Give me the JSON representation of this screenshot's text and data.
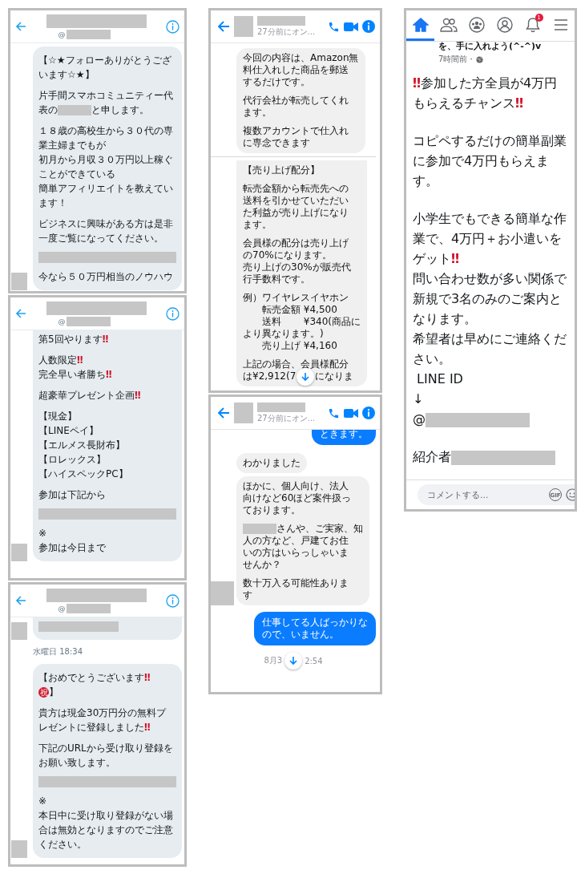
{
  "columns": [
    {
      "panels": [
        {
          "kind": "twitter_dm",
          "header": {
            "handle": "@"
          },
          "items": [
            {
              "kind": "received",
              "continued": false,
              "avatar": true,
              "paragraphs": [
                [
                  "【☆★フォローありがとうござ",
                  "います☆★】"
                ],
                [
                  "片手間スマホコミュニティー代",
                  [
                    {
                      "text": "表の"
                    },
                    {
                      "kind": "redacted_short"
                    },
                    {
                      "text": "と申します。"
                    }
                  ]
                ],
                [
                  "１８歳の高校生から３０代の専",
                  "業主婦までもが",
                  "初月から月収３０万円以上稼ぐ",
                  "ことができている",
                  "簡単アフィリエイトを教えてい",
                  "ます！"
                ],
                [
                  "ビジネスに興味がある方は是非",
                  "一度ご覧になってください。"
                ],
                [
                  [
                    {
                      "kind": "redacted_line"
                    }
                  ]
                ],
                [
                  "今なら５０万円相当のノウハウ"
                ]
              ]
            }
          ]
        },
        {
          "kind": "twitter_dm",
          "header": {
            "handle": "@"
          },
          "items": [
            {
              "kind": "received",
              "continued": true,
              "avatar": true,
              "paragraphs": [
                [
                  [
                    {
                      "text": "第5回やります"
                    },
                    {
                      "kind": "emoji",
                      "text": "‼"
                    }
                  ]
                ],
                [
                  [
                    {
                      "text": "人数限定"
                    },
                    {
                      "kind": "emoji",
                      "text": "‼"
                    }
                  ],
                  [
                    {
                      "text": "完全早い者勝ち"
                    },
                    {
                      "kind": "emoji",
                      "text": "‼"
                    }
                  ]
                ],
                [
                  [
                    {
                      "text": "超豪華プレゼント企画"
                    },
                    {
                      "kind": "emoji",
                      "text": "‼"
                    }
                  ]
                ],
                [
                  "【現金】",
                  "【LINEペイ】",
                  "【エルメス長財布】",
                  "【ロレックス】",
                  "【ハイスペックPC】"
                ],
                [
                  "参加は下記から"
                ],
                [
                  [
                    {
                      "kind": "redacted_line"
                    }
                  ]
                ],
                [
                  "※",
                  "参加は今日まで"
                ]
              ]
            }
          ]
        },
        {
          "kind": "twitter_dm",
          "header": {
            "handle": "@"
          },
          "items": [
            {
              "kind": "received",
              "continued": true,
              "avatar": true,
              "paragraphs": [
                [
                  [
                    {
                      "kind": "redacted_medium"
                    }
                  ]
                ]
              ]
            },
            {
              "kind": "timestamp",
              "segments": [
                {
                  "text": "水曜日 18:34"
                }
              ]
            },
            {
              "kind": "received",
              "continued": false,
              "avatar": true,
              "paragraphs": [
                [
                  [
                    {
                      "text": "【おめでとうございます"
                    },
                    {
                      "kind": "emoji",
                      "text": "‼"
                    }
                  ],
                  [
                    {
                      "kind": "badge",
                      "text": "祝"
                    },
                    {
                      "text": "】"
                    }
                  ]
                ],
                [
                  "貴方は現金30万円分の無料プ",
                  [
                    {
                      "text": "レゼントに登録しました"
                    },
                    {
                      "kind": "emoji",
                      "text": "‼"
                    }
                  ]
                ],
                [
                  "下記のURLから受け取り登録を",
                  "お願い致します。"
                ],
                [
                  [
                    {
                      "kind": "redacted_line"
                    }
                  ]
                ],
                [
                  "※",
                  "本日中に受け取り登録がない場",
                  "合は無効となりますのでご注意",
                  "ください。"
                ]
              ]
            }
          ]
        }
      ]
    },
    {
      "panels": [
        {
          "kind": "messenger",
          "header": {
            "status": "27分前にオン..."
          },
          "items": [
            {
              "kind": "received",
              "continued": false,
              "avatar": false,
              "paragraphs": [
                [
                  "今回の内容は、Amazon無",
                  "料仕入れした商品を郵送",
                  "するだけです。"
                ],
                [
                  "代行会社が転売してくれ",
                  "ます。"
                ],
                [
                  "複数アカウントで仕入れ",
                  "に専念できます"
                ]
              ]
            },
            {
              "kind": "divider"
            },
            {
              "kind": "received",
              "continued": true,
              "avatar": false,
              "paragraphs": [
                [
                  "【売り上げ配分】"
                ],
                [
                  "転売金額から転売先への",
                  "送料を引かせていただい",
                  "た利益が売り上げになり",
                  "ます。"
                ],
                [
                  "会員様の配分は売り上げ",
                  "の70%になります。",
                  "売り上げの30%が販売代",
                  "行手数料です。"
                ],
                [
                  "例）ワイヤレスイヤホン",
                  "　　転売金額 ¥4,500",
                  "　　送料　　 ¥340(商品に",
                  "より異なります。)",
                  "　　売り上げ ¥4,160"
                ],
                [
                  "上記の場合、会員様配分",
                  [
                    {
                      "text": "は¥2,912(7"
                    },
                    {
                      "kind": "scroll_button"
                    },
                    {
                      "text": "になりま"
                    }
                  ]
                ]
              ]
            }
          ]
        },
        {
          "kind": "messenger",
          "header": {
            "status": "27分前にオン..."
          },
          "items": [
            {
              "kind": "sent",
              "continued": true,
              "paragraphs": [
                [
                  "ときます。"
                ]
              ]
            },
            {
              "kind": "received",
              "continued": false,
              "avatar": false,
              "paragraphs": [
                [
                  "わかりました"
                ]
              ]
            },
            {
              "kind": "received",
              "continued": false,
              "avatar": true,
              "paragraphs": [
                [
                  "ほかに、個人向け、法人",
                  "向けなど60ほど案件扱っ",
                  "ております。"
                ],
                [
                  [
                    {
                      "kind": "redacted_short"
                    },
                    {
                      "text": "さんや、ご実家、知"
                    }
                  ],
                  "人の方など、戸建てお住",
                  "いの方はいらっしゃいま",
                  "せんか？"
                ],
                [
                  "数十万入る可能性ありま",
                  "す"
                ]
              ]
            },
            {
              "kind": "sent",
              "continued": false,
              "paragraphs": [
                [
                  "仕事してる人ばっかりな",
                  "ので、いません。"
                ]
              ]
            },
            {
              "kind": "timestamp",
              "segments": [
                {
                  "text": "8月3"
                },
                {
                  "kind": "scroll_button"
                },
                {
                  "text": "2:54"
                }
              ]
            }
          ]
        }
      ]
    },
    {
      "panels": [
        {
          "kind": "facebook",
          "tabs": [
            {
              "kind": "home",
              "selected": true
            },
            {
              "kind": "friends",
              "selected": false
            },
            {
              "kind": "groups",
              "selected": false
            },
            {
              "kind": "profile",
              "selected": false
            },
            {
              "kind": "notifications",
              "selected": false,
              "badge": "1"
            },
            {
              "kind": "menu",
              "selected": false
            }
          ],
          "post": {
            "title_fragment": "を、手に入れよう(^-^)v",
            "time": "7時間前・",
            "paragraphs": [
              [
                [
                  {
                    "kind": "emoji",
                    "text": "‼"
                  },
                  {
                    "text": "参加した方全員が4万円"
                  }
                ],
                [
                  {
                    "text": "もらえるチャンス"
                  },
                  {
                    "kind": "emoji",
                    "text": "‼"
                  }
                ]
              ],
              [
                "コピペするだけの簡単副業",
                "に参加で4万円もらえま",
                "す。"
              ],
              [
                "小学生でもできる簡単な作",
                "業で、4万円＋お小遣いを",
                [
                  {
                    "text": "ゲット"
                  },
                  {
                    "kind": "emoji",
                    "text": "‼"
                  }
                ],
                "問い合わせ数が多い関係で",
                "新規で3名のみのご案内と",
                "なります。",
                "希望者は早めにご連絡くだ",
                "さい。",
                " LINE ID",
                "↓",
                [
                  {
                    "text": "@"
                  },
                  {
                    "kind": "redacted_long"
                  }
                ]
              ],
              [
                [
                  {
                    "text": "紹介者"
                  },
                  {
                    "kind": "redacted_long"
                  }
                ]
              ]
            ]
          },
          "comment_bar": {
            "placeholder": "コメントする...",
            "gif_label": "GIF"
          }
        }
      ]
    }
  ]
}
